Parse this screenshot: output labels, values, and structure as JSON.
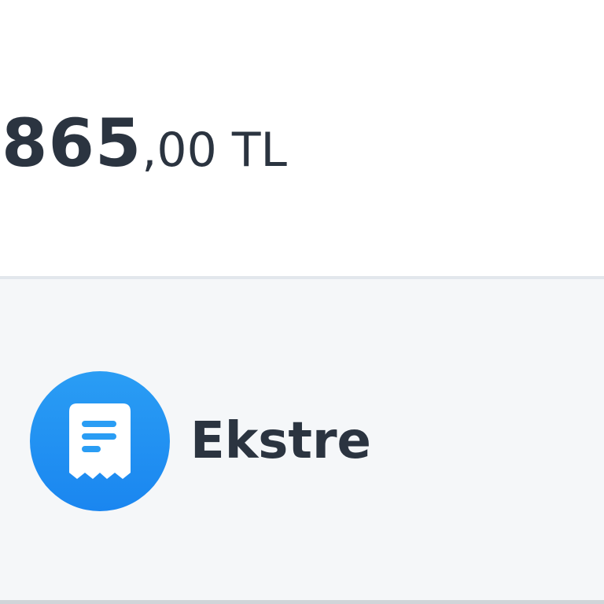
{
  "balance": {
    "integer_part": "865",
    "decimal_part": ",00 TL"
  },
  "actions": [
    {
      "label": "Ekstre",
      "icon": "receipt-icon",
      "icon_bg_color": "#1a86f0"
    }
  ],
  "colors": {
    "text": "#2b3440",
    "panel_background": "#f5f7f9",
    "divider": "#e2e7ec"
  }
}
